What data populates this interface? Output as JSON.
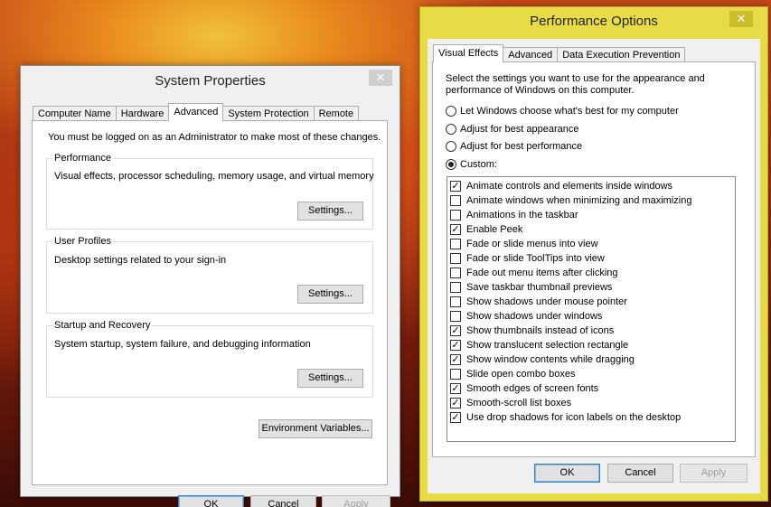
{
  "system_properties": {
    "title": "System Properties",
    "close_glyph": "✕",
    "tabs": [
      "Computer Name",
      "Hardware",
      "Advanced",
      "System Protection",
      "Remote"
    ],
    "admin_note": "You must be logged on as an Administrator to make most of these changes.",
    "performance": {
      "title": "Performance",
      "description": "Visual effects, processor scheduling, memory usage, and virtual memory",
      "button": "Settings..."
    },
    "user_profiles": {
      "title": "User Profiles",
      "description": "Desktop settings related to your sign-in",
      "button": "Settings..."
    },
    "startup_recovery": {
      "title": "Startup and Recovery",
      "description": "System startup, system failure, and debugging information",
      "button": "Settings..."
    },
    "env_button": "Environment Variables...",
    "ok": "OK",
    "cancel": "Cancel",
    "apply": "Apply"
  },
  "performance_options": {
    "title": "Performance Options",
    "close_glyph": "✕",
    "tabs": [
      "Visual Effects",
      "Advanced",
      "Data Execution Prevention"
    ],
    "intro_line1": "Select the settings you want to use for the appearance and",
    "intro_line2": "performance of Windows on this computer.",
    "radios": [
      {
        "label": "Let Windows choose what's best for my computer",
        "selected": false
      },
      {
        "label": "Adjust for best appearance",
        "selected": false
      },
      {
        "label": "Adjust for best performance",
        "selected": false
      },
      {
        "label": "Custom:",
        "selected": true
      }
    ],
    "effects": [
      {
        "label": "Animate controls and elements inside windows",
        "checked": true
      },
      {
        "label": "Animate windows when minimizing and maximizing",
        "checked": false
      },
      {
        "label": "Animations in the taskbar",
        "checked": false
      },
      {
        "label": "Enable Peek",
        "checked": true
      },
      {
        "label": "Fade or slide menus into view",
        "checked": false
      },
      {
        "label": "Fade or slide ToolTips into view",
        "checked": false
      },
      {
        "label": "Fade out menu items after clicking",
        "checked": false
      },
      {
        "label": "Save taskbar thumbnail previews",
        "checked": false
      },
      {
        "label": "Show shadows under mouse pointer",
        "checked": false
      },
      {
        "label": "Show shadows under windows",
        "checked": false
      },
      {
        "label": "Show thumbnails instead of icons",
        "checked": true
      },
      {
        "label": "Show translucent selection rectangle",
        "checked": true
      },
      {
        "label": "Show window contents while dragging",
        "checked": true
      },
      {
        "label": "Slide open combo boxes",
        "checked": false
      },
      {
        "label": "Smooth edges of screen fonts",
        "checked": true
      },
      {
        "label": "Smooth-scroll list boxes",
        "checked": true
      },
      {
        "label": "Use drop shadows for icon labels on the desktop",
        "checked": true
      }
    ],
    "ok": "OK",
    "cancel": "Cancel",
    "apply": "Apply"
  },
  "colors": {
    "desktop_accent": "#d9541a",
    "perf_window_frame": "#e8dc46",
    "dialog_bg": "#f0f0f0",
    "default_button_border": "#3c7fb1"
  }
}
